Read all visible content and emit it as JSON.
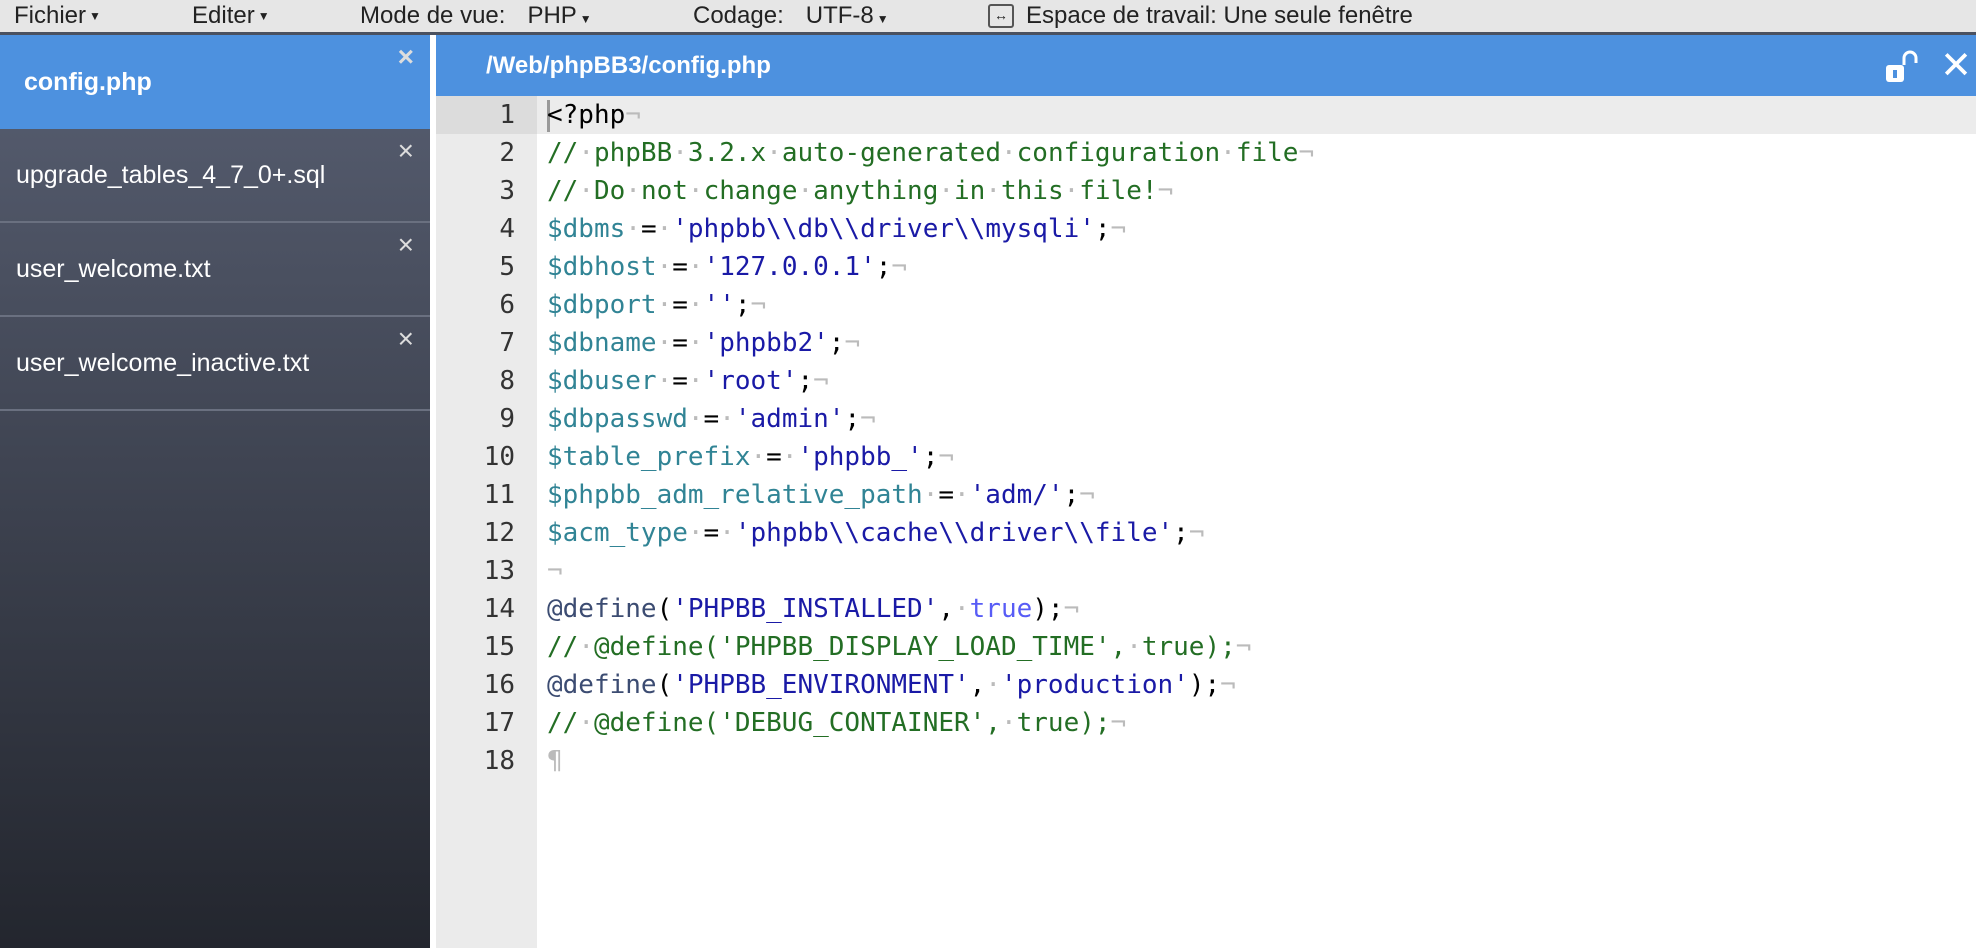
{
  "toolbar": {
    "file_menu": "Fichier",
    "edit_menu": "Editer",
    "view_mode_label": "Mode de vue:",
    "view_mode_value": "PHP",
    "encoding_label": "Codage:",
    "encoding_value": "UTF-8",
    "workspace_label": "Espace de travail: Une seule fenêtre"
  },
  "tabs": [
    {
      "label": "config.php",
      "active": true
    },
    {
      "label": "upgrade_tables_4_7_0+.sql"
    },
    {
      "label": "user_welcome.txt"
    },
    {
      "label": "user_welcome_inactive.txt"
    }
  ],
  "tab_close": "×",
  "editor": {
    "path": "/Web/phpBB3/config.php",
    "close": "✕",
    "active_line": 1,
    "lines": [
      "<?php",
      "// phpBB 3.2.x auto-generated configuration file",
      "// Do not change anything in this file!",
      "$dbms = 'phpbb\\\\db\\\\driver\\\\mysqli';",
      "$dbhost = '127.0.0.1';",
      "$dbport = '';",
      "$dbname = 'phpbb2';",
      "$dbuser = 'root';",
      "$dbpasswd = 'admin';",
      "$table_prefix = 'phpbb_';",
      "$phpbb_adm_relative_path = 'adm/';",
      "$acm_type = 'phpbb\\\\cache\\\\driver\\\\file';",
      "",
      "@define('PHPBB_INSTALLED', true);",
      "// @define('PHPBB_DISPLAY_LOAD_TIME', true);",
      "@define('PHPBB_ENVIRONMENT', 'production');",
      "// @define('DEBUG_CONTAINER', true);",
      ""
    ]
  },
  "colors": {
    "accent": "#4d91df",
    "comment": "#236e24",
    "string": "#1a1aa6",
    "variable": "#318495",
    "constant": "#585cf6"
  }
}
